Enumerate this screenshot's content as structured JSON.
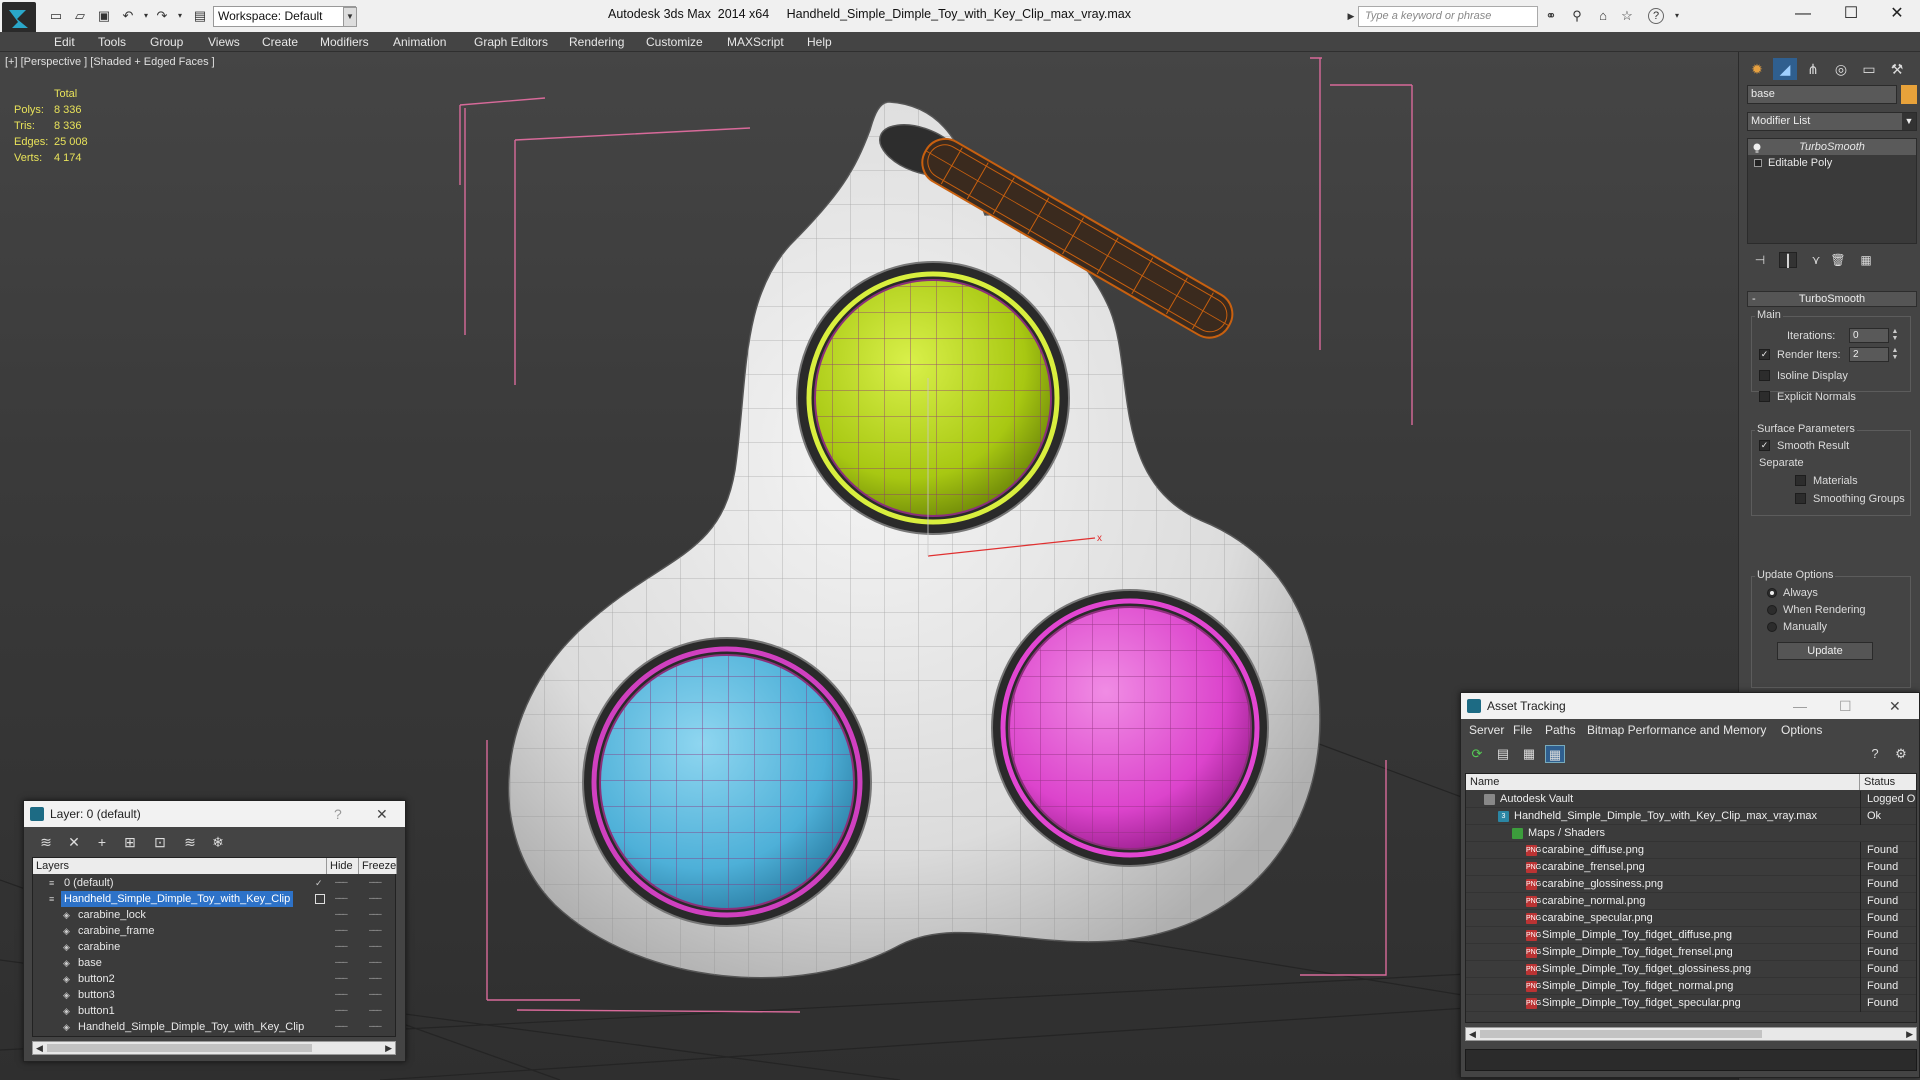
{
  "titlebar": {
    "workspace_label": "Workspace: Default",
    "app_title": "Autodesk 3ds Max  2014 x64",
    "file_title": "Handheld_Simple_Dimple_Toy_with_Key_Clip_max_vray.max",
    "search_placeholder": "Type a keyword or phrase"
  },
  "menu": [
    "Edit",
    "Tools",
    "Group",
    "Views",
    "Create",
    "Modifiers",
    "Animation",
    "Graph Editors",
    "Rendering",
    "Customize",
    "MAXScript",
    "Help"
  ],
  "viewport": {
    "label": "[+] [Perspective ] [Shaded + Edged Faces ]",
    "stats": {
      "header": "Total",
      "rows": [
        {
          "label": "Polys:",
          "value": "8 336"
        },
        {
          "label": "Tris:",
          "value": "8 336"
        },
        {
          "label": "Edges:",
          "value": "25 008"
        },
        {
          "label": "Verts:",
          "value": "4 174"
        }
      ]
    },
    "gizmo_axis": "x",
    "colors": {
      "button_top": "#b8dc1a",
      "button_left": "#5bbde0",
      "button_right": "#e24bd2",
      "carabine": "#c8600f",
      "body": "#e2e2e2"
    }
  },
  "command_panel": {
    "object_name": "base",
    "modifier_list": "Modifier List",
    "stack": [
      "TurboSmooth",
      "Editable Poly"
    ],
    "rollout": "TurboSmooth",
    "main_group": "Main",
    "iterations_label": "Iterations:",
    "iterations_value": "0",
    "render_iters_label": "Render Iters:",
    "render_iters_value": "2",
    "isoline": "Isoline Display",
    "explicit_normals": "Explicit Normals",
    "surface_group": "Surface Parameters",
    "smooth_result": "Smooth Result",
    "separate": "Separate",
    "materials": "Materials",
    "smoothing_groups": "Smoothing Groups",
    "update_group": "Update Options",
    "always": "Always",
    "when_rendering": "When Rendering",
    "manually": "Manually",
    "update_button": "Update"
  },
  "layer_window": {
    "title": "Layer: 0 (default)",
    "help": "?",
    "columns": [
      "Layers",
      "Hide",
      "Freeze"
    ],
    "rows": [
      {
        "name": "0 (default)",
        "level": 0,
        "selected": false,
        "current": true
      },
      {
        "name": "Handheld_Simple_Dimple_Toy_with_Key_Clip",
        "level": 0,
        "selected": true,
        "current": false
      },
      {
        "name": "carabine_lock",
        "level": 1,
        "selected": false,
        "current": false
      },
      {
        "name": "carabine_frame",
        "level": 1,
        "selected": false,
        "current": false
      },
      {
        "name": "carabine",
        "level": 1,
        "selected": false,
        "current": false
      },
      {
        "name": "base",
        "level": 1,
        "selected": false,
        "current": false
      },
      {
        "name": "button2",
        "level": 1,
        "selected": false,
        "current": false
      },
      {
        "name": "button3",
        "level": 1,
        "selected": false,
        "current": false
      },
      {
        "name": "button1",
        "level": 1,
        "selected": false,
        "current": false
      },
      {
        "name": "Handheld_Simple_Dimple_Toy_with_Key_Clip",
        "level": 1,
        "selected": false,
        "current": false
      }
    ]
  },
  "asset_window": {
    "title": "Asset Tracking",
    "menu": [
      "Server",
      "File",
      "Paths",
      "Bitmap Performance and Memory",
      "Options"
    ],
    "columns": [
      "Name",
      "Status"
    ],
    "rows": [
      {
        "name": "Autodesk Vault",
        "status": "Logged O",
        "icon": "vault",
        "level": 1
      },
      {
        "name": "Handheld_Simple_Dimple_Toy_with_Key_Clip_max_vray.max",
        "status": "Ok",
        "icon": "max",
        "level": 2
      },
      {
        "name": "Maps / Shaders",
        "status": "",
        "icon": "maps",
        "level": 3
      },
      {
        "name": "carabine_diffuse.png",
        "status": "Found",
        "icon": "png",
        "level": 4
      },
      {
        "name": "carabine_frensel.png",
        "status": "Found",
        "icon": "png",
        "level": 4
      },
      {
        "name": "carabine_glossiness.png",
        "status": "Found",
        "icon": "png",
        "level": 4
      },
      {
        "name": "carabine_normal.png",
        "status": "Found",
        "icon": "png",
        "level": 4
      },
      {
        "name": "carabine_specular.png",
        "status": "Found",
        "icon": "png",
        "level": 4
      },
      {
        "name": "Simple_Dimple_Toy_fidget_diffuse.png",
        "status": "Found",
        "icon": "png",
        "level": 4
      },
      {
        "name": "Simple_Dimple_Toy_fidget_frensel.png",
        "status": "Found",
        "icon": "png",
        "level": 4
      },
      {
        "name": "Simple_Dimple_Toy_fidget_glossiness.png",
        "status": "Found",
        "icon": "png",
        "level": 4
      },
      {
        "name": "Simple_Dimple_Toy_fidget_normal.png",
        "status": "Found",
        "icon": "png",
        "level": 4
      },
      {
        "name": "Simple_Dimple_Toy_fidget_specular.png",
        "status": "Found",
        "icon": "png",
        "level": 4
      }
    ]
  }
}
